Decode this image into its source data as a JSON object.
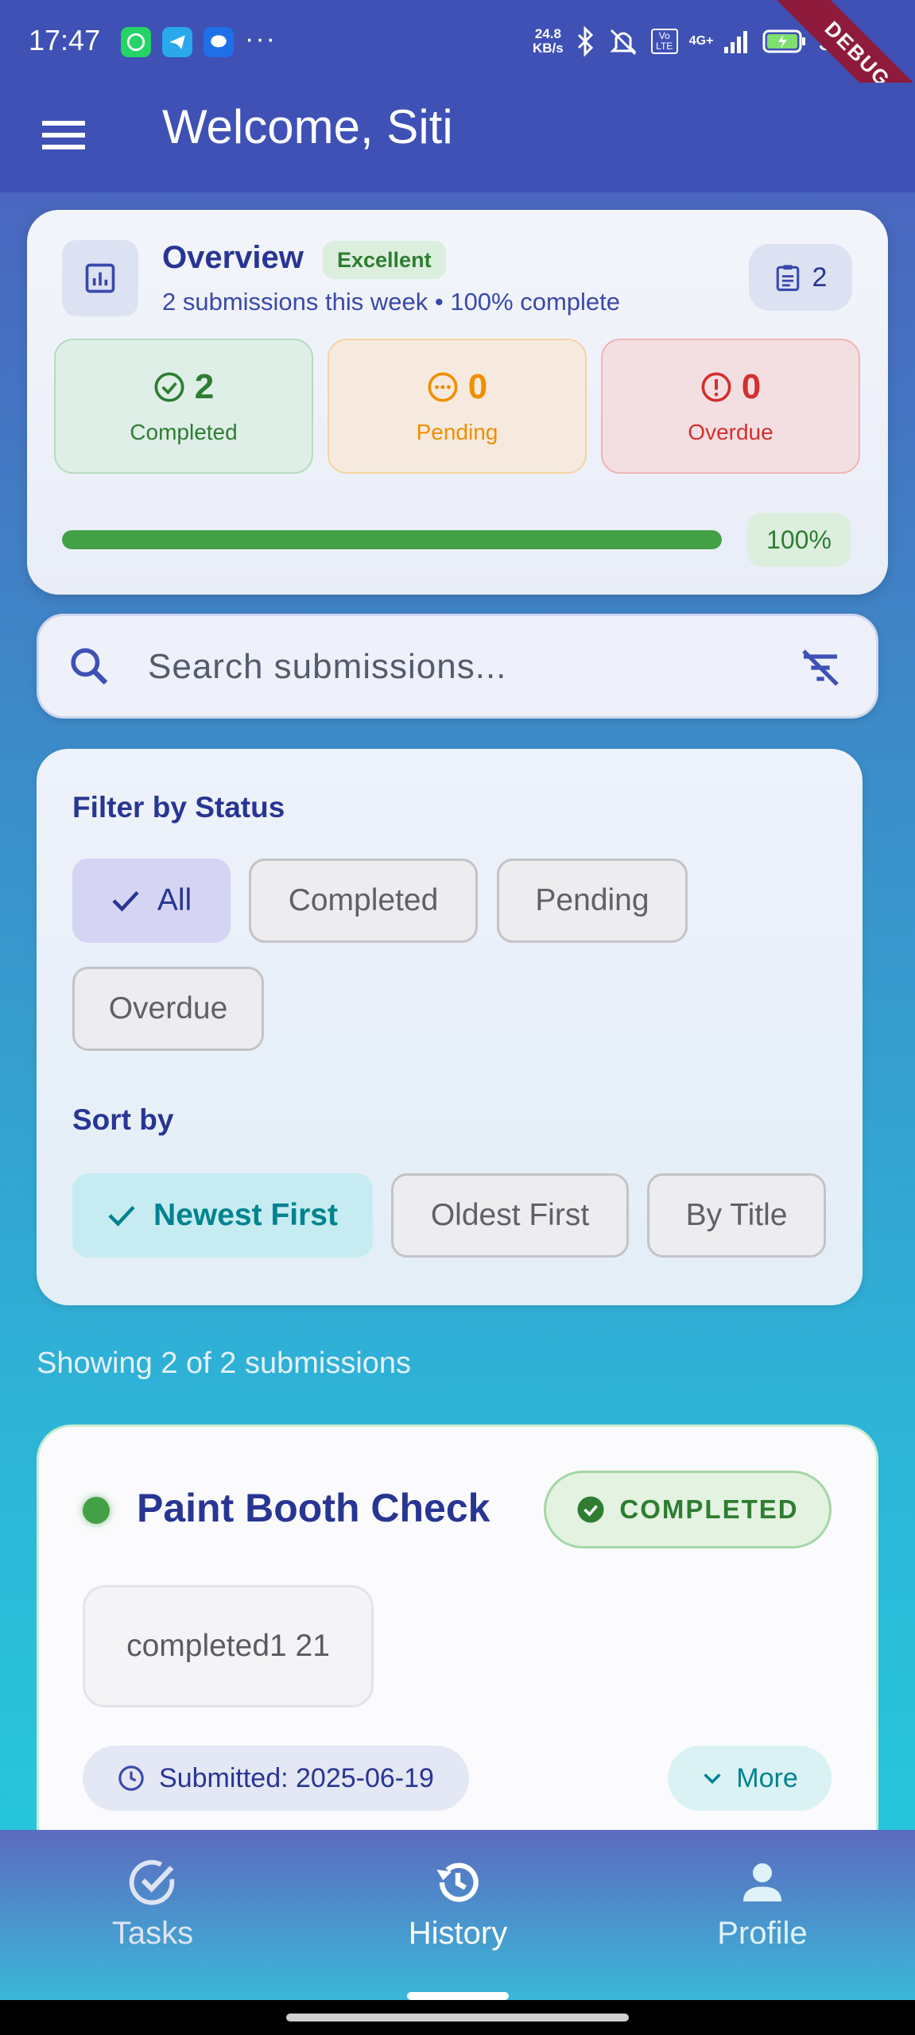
{
  "status_bar": {
    "time": "17:47",
    "net_speed_value": "24.8",
    "net_speed_unit": "KB/s",
    "network": "4G+",
    "volte": "Vo LTE",
    "battery": "55",
    "debug_banner": "DEBUG",
    "more": "···"
  },
  "app_bar": {
    "title": "Welcome, Siti"
  },
  "overview": {
    "title": "Overview",
    "badge": "Excellent",
    "subtitle": "2 submissions this week • 100% complete",
    "count": "2",
    "stats": [
      {
        "value": "2",
        "label": "Completed"
      },
      {
        "value": "0",
        "label": "Pending"
      },
      {
        "value": "0",
        "label": "Overdue"
      }
    ],
    "progress_fraction": 1.0,
    "progress_label": "100%"
  },
  "search": {
    "placeholder": "Search submissions..."
  },
  "filter": {
    "status_title": "Filter by Status",
    "status_options": [
      "All",
      "Completed",
      "Pending",
      "Overdue"
    ],
    "status_selected": "All",
    "sort_title": "Sort by",
    "sort_options": [
      "Newest First",
      "Oldest First",
      "By Title"
    ],
    "sort_selected": "Newest First"
  },
  "results": {
    "showing": "Showing 2 of 2 submissions"
  },
  "submission": {
    "title": "Paint Booth Check",
    "status": "COMPLETED",
    "note": "completed1 21",
    "submitted": "Submitted: 2025-06-19",
    "more_label": "More"
  },
  "bottom_nav": {
    "items": [
      {
        "label": "Tasks",
        "icon": "check-circle-icon"
      },
      {
        "label": "History",
        "icon": "history-icon"
      },
      {
        "label": "Profile",
        "icon": "person-icon"
      }
    ],
    "active": "History"
  },
  "colors": {
    "primary": "#3f51b5",
    "success": "#2e7d32",
    "warning": "#ef8f00",
    "danger": "#d32f2f",
    "accent": "#00838f"
  }
}
